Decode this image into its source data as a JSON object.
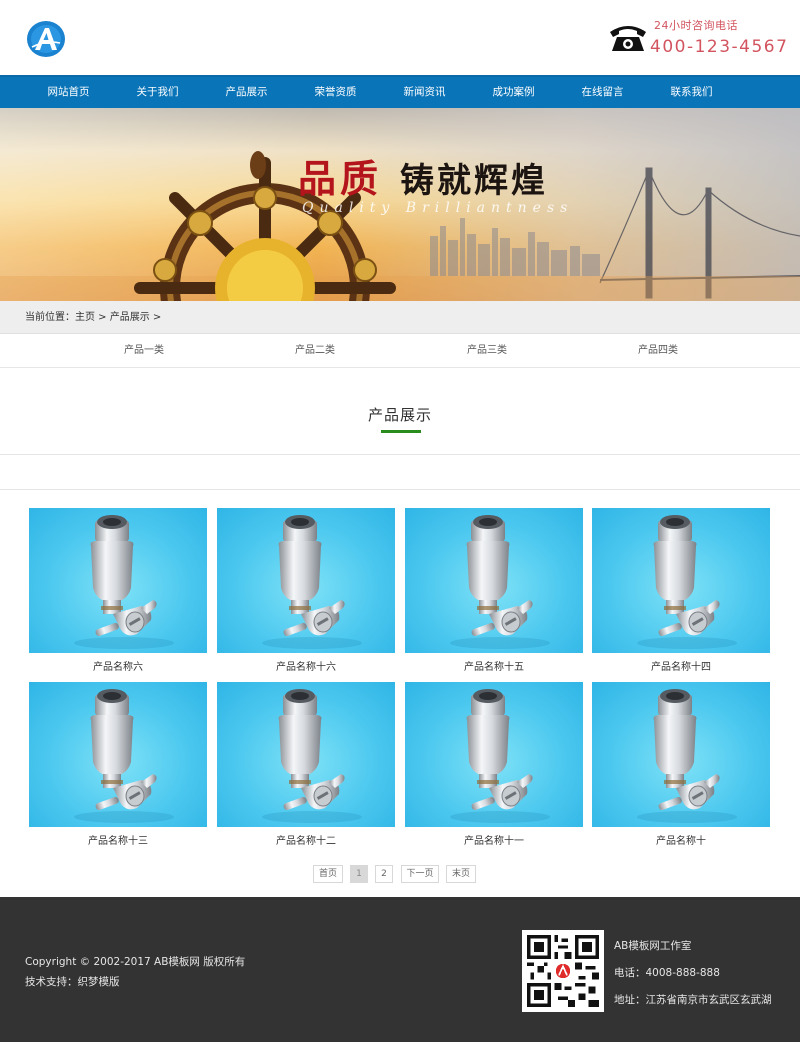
{
  "header": {
    "hotline_label": "24小时咨询电话",
    "hotline_number": "400-123-4567",
    "logo_icon": "ab-logo-icon",
    "phone_icon": "telephone-icon",
    "accent_color": "#d2545f"
  },
  "nav": {
    "color": "#0a74b8",
    "items": [
      {
        "label": "网站首页"
      },
      {
        "label": "关于我们"
      },
      {
        "label": "产品展示"
      },
      {
        "label": "荣誉资质"
      },
      {
        "label": "新闻资讯"
      },
      {
        "label": "成功案例"
      },
      {
        "label": "在线留言"
      },
      {
        "label": "联系我们"
      }
    ]
  },
  "banner": {
    "title_red": "品质",
    "title_black": "铸就辉煌",
    "subtitle": "Quality Brilliantness"
  },
  "breadcrumb": {
    "label": "当前位置：",
    "home": "主页",
    "sep": " > ",
    "current": "产品展示",
    "trail_end": " >"
  },
  "categories": [
    {
      "label": "产品一类"
    },
    {
      "label": "产品二类"
    },
    {
      "label": "产品三类"
    },
    {
      "label": "产品四类"
    }
  ],
  "section": {
    "title": "产品展示",
    "underline_color": "#2b8c1e"
  },
  "products": [
    {
      "name": "产品名称六"
    },
    {
      "name": "产品名称十六"
    },
    {
      "name": "产品名称十五"
    },
    {
      "name": "产品名称十四"
    },
    {
      "name": "产品名称十三"
    },
    {
      "name": "产品名称十二"
    },
    {
      "name": "产品名称十一"
    },
    {
      "name": "产品名称十"
    }
  ],
  "pagination": {
    "first": "首页",
    "page1": "1",
    "page2": "2",
    "next": "下一页",
    "last": "末页",
    "current_page": 1
  },
  "footer": {
    "copyright": "Copyright © 2002-2017 AB模板网 版权所有",
    "support": "技术支持：织梦模版",
    "studio": "AB模板网工作室",
    "phone": "电话：4008-888-888",
    "address": "地址：江苏省南京市玄武区玄武湖",
    "qr_icon": "qr-code-icon"
  }
}
